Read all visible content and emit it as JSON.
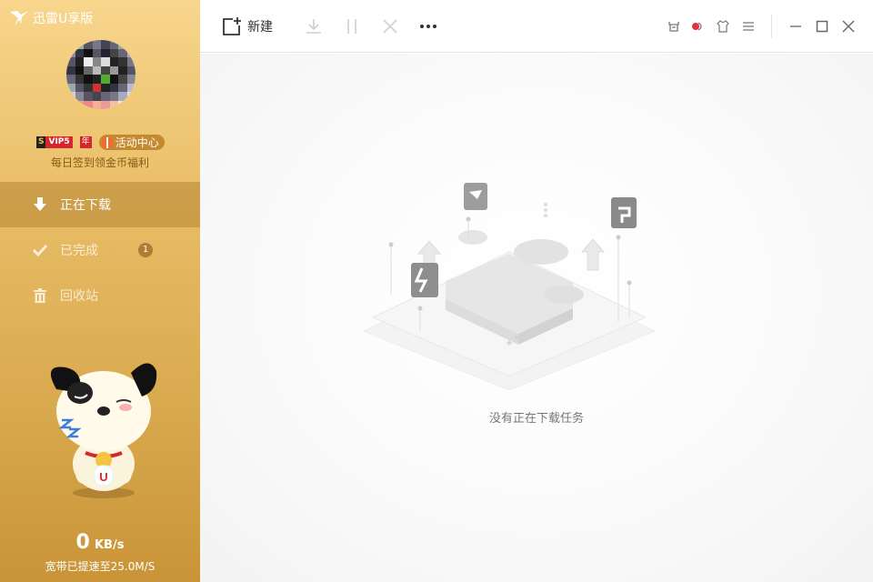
{
  "app": {
    "title": "迅雷U享版"
  },
  "user": {
    "vip_mark": "S",
    "vip_label": "VIP5",
    "year_label": "年",
    "activity_label": "活动中心",
    "checkin_text": "每日签到领金币福利"
  },
  "nav": {
    "downloading": "正在下载",
    "completed": "已完成",
    "completed_count": "1",
    "trash": "回收站"
  },
  "toolbar": {
    "new_label": "新建"
  },
  "status": {
    "speed_value": "0",
    "speed_unit": "KB/s",
    "boost_text": "宽带已提速至25.0M/S"
  },
  "main": {
    "empty_text": "没有正在下载任务"
  },
  "colors": {
    "sidebar_top": "#f8d68d",
    "sidebar_bottom": "#c99437",
    "accent_red": "#d8262e"
  }
}
